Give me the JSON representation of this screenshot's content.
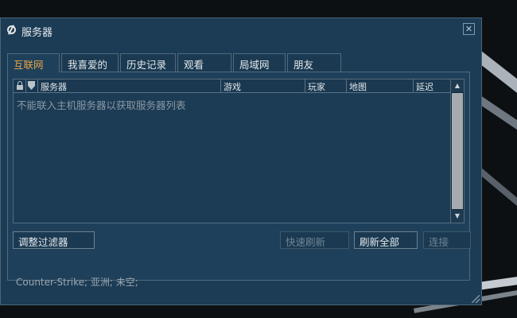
{
  "window": {
    "title": "服务器",
    "close_glyph": "✕"
  },
  "tabs": [
    {
      "label": "互联网",
      "active": true
    },
    {
      "label": "我喜爱的",
      "active": false
    },
    {
      "label": "历史记录",
      "active": false
    },
    {
      "label": "观看",
      "active": false
    },
    {
      "label": "局域网",
      "active": false
    },
    {
      "label": "朋友",
      "active": false
    }
  ],
  "table": {
    "columns": {
      "server": "服务器",
      "game": "游戏",
      "players": "玩家",
      "map": "地图",
      "latency": "延迟"
    },
    "icons": [
      "lock-icon",
      "shield-icon"
    ],
    "empty_message": "不能联入主机服务器以获取服务器列表"
  },
  "buttons": {
    "filter": "调整过滤器",
    "quick_refresh": "快速刷新",
    "refresh_all": "刷新全部",
    "connect": "连接"
  },
  "status_text": "Counter-Strike; 亚洲; 未空;",
  "colors": {
    "window_bg": "#1c3b54",
    "active_tab_text": "#e4a64a",
    "border": "#4f6a7e"
  }
}
